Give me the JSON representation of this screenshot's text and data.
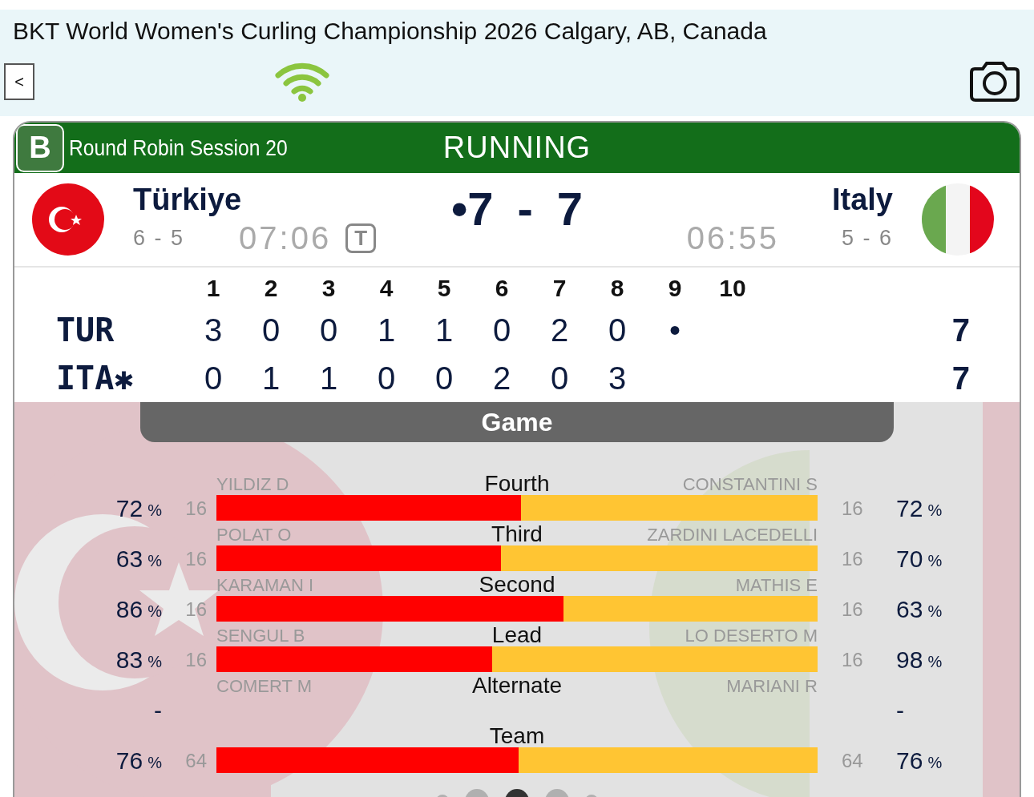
{
  "header": {
    "title": "BKT World Women's Curling Championship 2026 Calgary, AB, Canada",
    "back_button": "<"
  },
  "game": {
    "sheet": "B",
    "session": "Round Robin Session 20",
    "status": "RUNNING",
    "home": {
      "name": "Türkiye",
      "record": "6 - 5",
      "clock": "07:06",
      "timeout": "T"
    },
    "away": {
      "name": "Italy",
      "record": "5 - 6",
      "clock": "06:55"
    },
    "score": {
      "home": "•7",
      "separator": "-",
      "away": "7"
    }
  },
  "linescore": {
    "ends": [
      "1",
      "2",
      "3",
      "4",
      "5",
      "6",
      "7",
      "8",
      "9",
      "10"
    ],
    "rows": [
      {
        "team": "TUR",
        "ends": [
          "3",
          "0",
          "0",
          "1",
          "1",
          "0",
          "2",
          "0",
          "•"
        ],
        "total": "7"
      },
      {
        "team": "ITA✱",
        "ends": [
          "0",
          "1",
          "1",
          "0",
          "0",
          "2",
          "0",
          "3"
        ],
        "total": "7"
      }
    ]
  },
  "stats": {
    "tab": "Game",
    "rows": [
      {
        "kind": "bar",
        "position": "Fourth",
        "home_player": "YILDIZ D",
        "away_player": "CONSTANTINI S",
        "home_pct": "72",
        "home_unit": "%",
        "home_shots": "16",
        "away_shots": "16",
        "away_pct": "72",
        "away_unit": "%",
        "level": 0.507
      },
      {
        "kind": "bar",
        "position": "Third",
        "home_player": "POLAT O",
        "away_player": "ZARDINI LACEDELLI",
        "home_pct": "63",
        "home_unit": "%",
        "home_shots": "16",
        "away_shots": "16",
        "away_pct": "70",
        "away_unit": "%",
        "level": 0.473
      },
      {
        "kind": "bar",
        "position": "Second",
        "home_player": "KARAMAN I",
        "away_player": "MATHIS E",
        "home_pct": "86",
        "home_unit": "%",
        "home_shots": "16",
        "away_shots": "16",
        "away_pct": "63",
        "away_unit": "%",
        "level": 0.577
      },
      {
        "kind": "bar",
        "position": "Lead",
        "home_player": "SENGUL B",
        "away_player": "LO DESERTO M",
        "home_pct": "83",
        "home_unit": "%",
        "home_shots": "16",
        "away_shots": "16",
        "away_pct": "98",
        "away_unit": "%",
        "level": 0.459
      },
      {
        "kind": "none",
        "position": "Alternate",
        "home_player": "COMERT M",
        "away_player": "MARIANI R",
        "home_pct": "-",
        "away_pct": "-"
      },
      {
        "kind": "bar",
        "position": "Team",
        "home_pct": "76",
        "home_unit": "%",
        "home_shots": "64",
        "away_shots": "64",
        "away_pct": "76",
        "away_unit": "%",
        "level": 0.503
      }
    ]
  },
  "pager": [
    {
      "selected": false
    },
    {
      "selected": false
    },
    {
      "selected": true
    },
    {
      "selected": false
    },
    {
      "selected": false
    }
  ]
}
